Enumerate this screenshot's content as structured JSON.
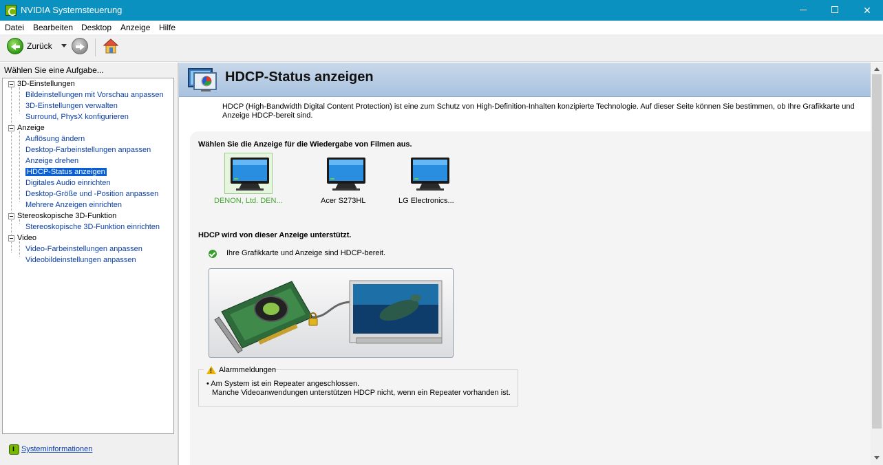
{
  "window": {
    "title": "NVIDIA Systemsteuerung",
    "minimize_icon": "minimize-icon",
    "maximize_icon": "maximize-icon",
    "close_glyph": "✕"
  },
  "menu": [
    "Datei",
    "Bearbeiten",
    "Desktop",
    "Anzeige",
    "Hilfe"
  ],
  "toolbar": {
    "back_label": "Zurück",
    "icons": [
      "back-arrow-icon",
      "dropdown-arrow-icon",
      "forward-arrow-icon",
      "home-icon"
    ]
  },
  "left_panel": {
    "task_header": "Wählen Sie eine Aufgabe...",
    "tree": [
      {
        "label": "3D-Einstellungen",
        "children": [
          "Bildeinstellungen mit Vorschau anpassen",
          "3D-Einstellungen verwalten",
          "Surround, PhysX konfigurieren"
        ]
      },
      {
        "label": "Anzeige",
        "children": [
          "Auflösung ändern",
          "Desktop-Farbeinstellungen anpassen",
          "Anzeige drehen",
          "HDCP-Status anzeigen",
          "Digitales Audio einrichten",
          "Desktop-Größe und -Position anpassen",
          "Mehrere Anzeigen einrichten"
        ]
      },
      {
        "label": "Stereoskopische 3D-Funktion",
        "children": [
          "Stereoskopische 3D-Funktion einrichten"
        ]
      },
      {
        "label": "Video",
        "children": [
          "Video-Farbeinstellungen anpassen",
          "Videobildeinstellungen anpassen"
        ]
      }
    ],
    "selected_item": "HDCP-Status anzeigen",
    "sysinfo_link": "Systeminformationen"
  },
  "main": {
    "title": "HDCP-Status anzeigen",
    "description": "HDCP (High-Bandwidth Digital Content Protection) ist eine zum Schutz von High-Definition-Inhalten konzipierte Technologie. Auf dieser Seite können Sie bestimmen, ob Ihre Grafikkarte und Anzeige HDCP-bereit sind.",
    "select_display_title": "Wählen Sie die Anzeige für die Wiedergabe von Filmen aus.",
    "displays": [
      {
        "label": "DENON, Ltd. DEN...",
        "selected": true
      },
      {
        "label": "Acer S273HL",
        "selected": false
      },
      {
        "label": "LG Electronics...",
        "selected": false
      }
    ],
    "hdcp_supported_title": "HDCP wird von dieser Anzeige unterstützt.",
    "status_text": "Ihre Grafikkarte und Anzeige sind HDCP-bereit.",
    "alarm": {
      "title": "Alarmmeldungen",
      "lines": [
        "• Am System ist ein Repeater angeschlossen.",
        "Manche Videoanwendungen unterstützen HDCP nicht, wenn ein Repeater vorhanden ist."
      ]
    }
  },
  "colors": {
    "titlebar": "#0a91c0",
    "accent_green": "#76b900",
    "selected_display_label": "#40a92b",
    "link_blue": "#0b3fa8",
    "selection_blue": "#0a5fd6"
  }
}
